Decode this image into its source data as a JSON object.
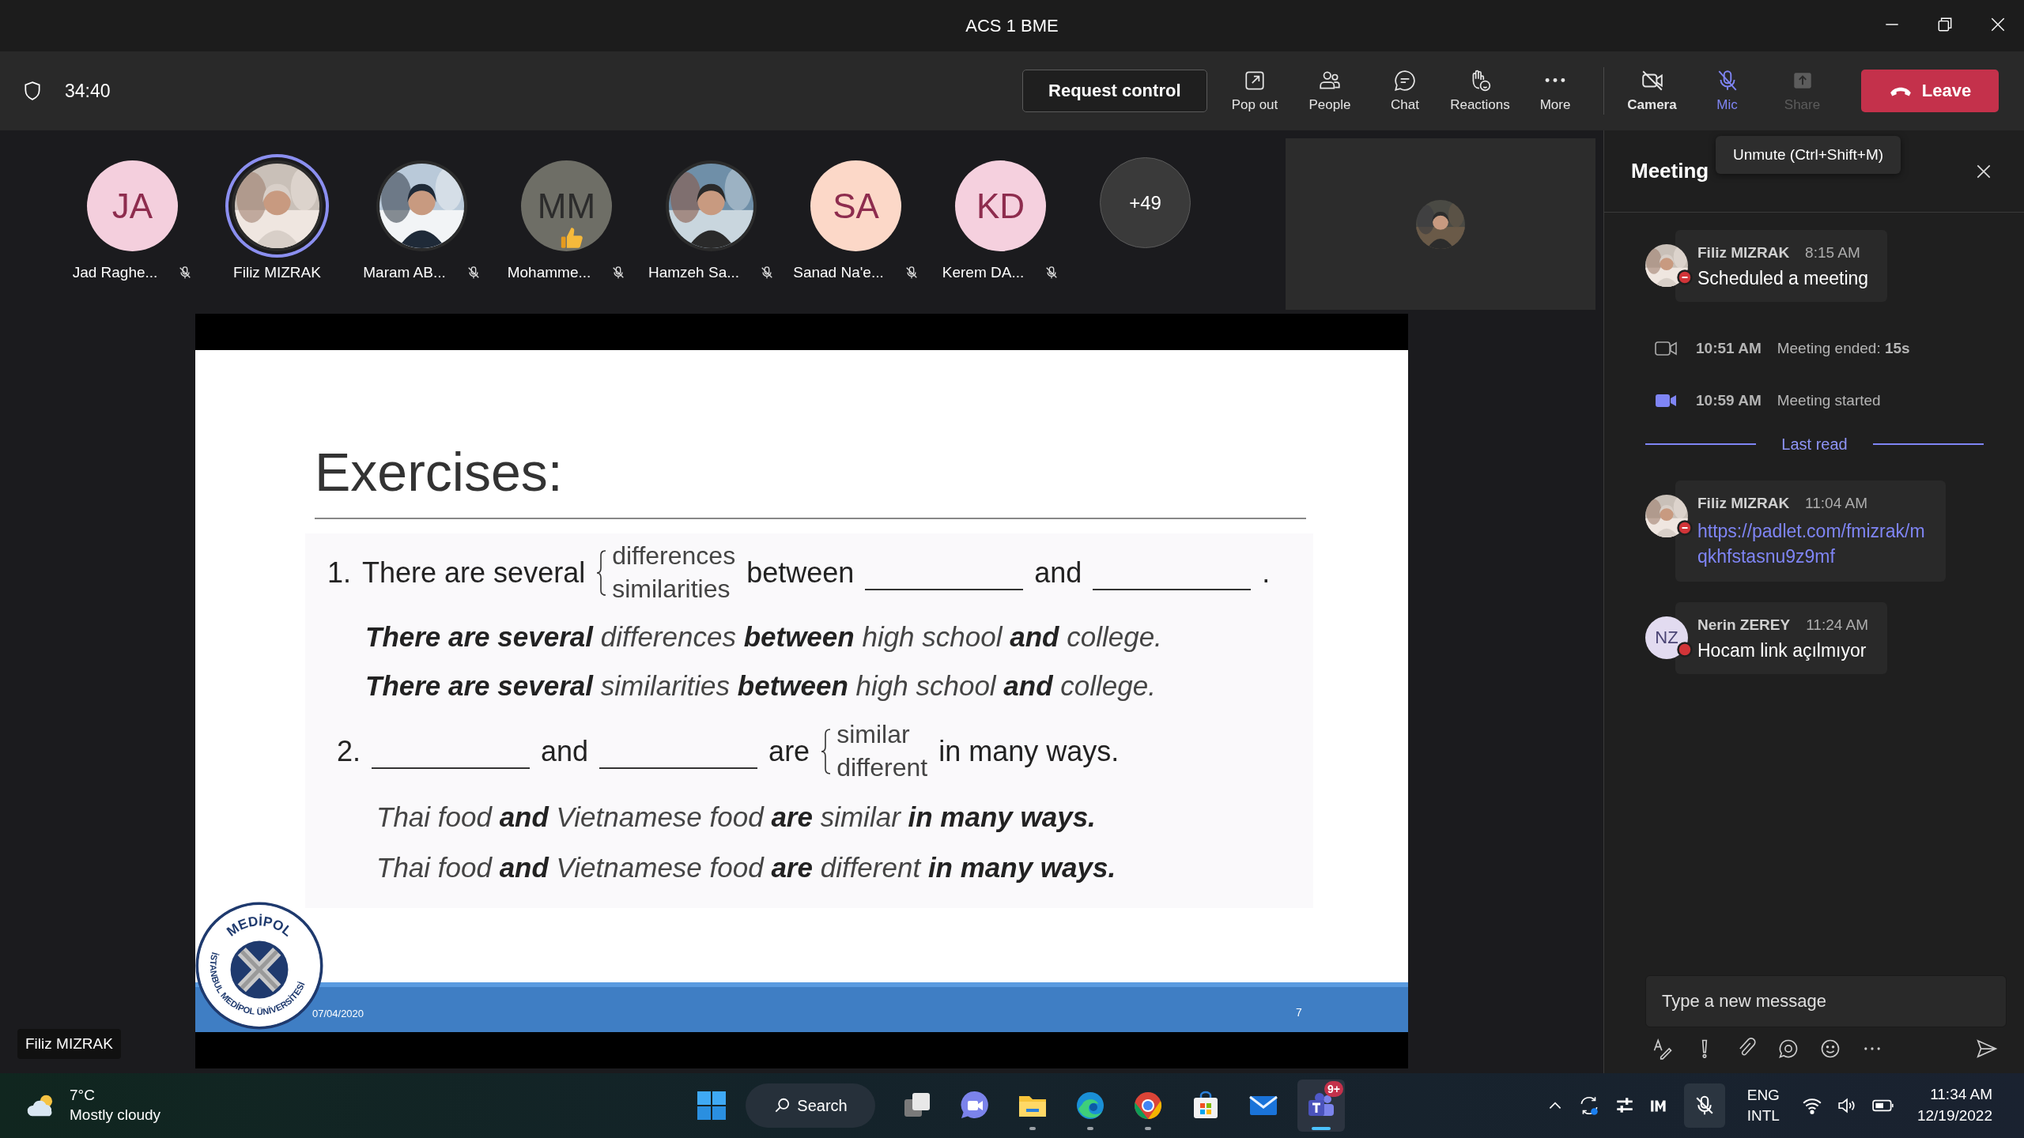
{
  "window": {
    "title": "ACS 1 BME"
  },
  "meeting_bar": {
    "timer": "34:40",
    "request_control": "Request control",
    "actions": [
      {
        "label": "Pop out",
        "kind": "popout"
      },
      {
        "label": "People",
        "kind": "people"
      },
      {
        "label": "Chat",
        "kind": "chat"
      },
      {
        "label": "Reactions",
        "kind": "reactions"
      },
      {
        "label": "More",
        "kind": "more"
      }
    ],
    "devices": [
      {
        "label": "Camera",
        "kind": "camera",
        "on": false,
        "selected": false,
        "disabled": false
      },
      {
        "label": "Mic",
        "kind": "mic",
        "on": false,
        "selected": true,
        "disabled": false
      },
      {
        "label": "Share",
        "kind": "share",
        "on": false,
        "selected": false,
        "disabled": true
      }
    ],
    "leave": "Leave"
  },
  "tooltip": "Unmute (Ctrl+Shift+M)",
  "participants": [
    {
      "kind": "initials",
      "initials": "JA",
      "color": "#f4cfdd",
      "name": "Jad Raghe...",
      "muted": true,
      "speaking": false,
      "reacted": false
    },
    {
      "name": "Filiz MIZRAK",
      "muted": false,
      "speaking": true,
      "reacted": false
    },
    {
      "name": "Maram AB...",
      "muted": true,
      "speaking": false,
      "reacted": false
    },
    {
      "kind": "initials",
      "initials": "MM",
      "color": "#6e6e66",
      "name": "Mohamme...",
      "muted": true,
      "speaking": false,
      "reacted": true
    },
    {
      "name": "Hamzeh Sa...",
      "muted": true,
      "speaking": false,
      "reacted": false
    },
    {
      "kind": "initials",
      "initials": "SA",
      "color": "#fcd8c8",
      "name": "Sanad Na'e...",
      "muted": true,
      "speaking": false,
      "reacted": false
    },
    {
      "kind": "initials",
      "initials": "KD",
      "color": "#f5d0de",
      "name": "Kerem DA...",
      "muted": true,
      "speaking": false,
      "reacted": false
    }
  ],
  "more_participants": "+49",
  "presenter": "Filiz MIZRAK",
  "slide": {
    "title": "Exercises:",
    "exercises": [
      {
        "number": "1.",
        "parts": [
          {
            "kind": "text",
            "text": "There are several"
          },
          {
            "kind": "choice",
            "options": [
              "differences",
              "similarities"
            ]
          },
          {
            "kind": "text",
            "text": "between"
          },
          {
            "kind": "blank"
          },
          {
            "kind": "text",
            "text": "and"
          },
          {
            "kind": "blank"
          },
          {
            "kind": "text",
            "text": "."
          }
        ],
        "examples": [
          "**There are several** differences **between** high school **and** college.",
          "**There are several** similarities **between** high school **and** college."
        ]
      },
      {
        "number": "2.",
        "parts": [
          {
            "kind": "blank"
          },
          {
            "kind": "text",
            "text": "and"
          },
          {
            "kind": "blank"
          },
          {
            "kind": "text",
            "text": "are"
          },
          {
            "kind": "choice",
            "options": [
              "similar",
              "different"
            ]
          },
          {
            "kind": "text",
            "text": "in many ways."
          }
        ],
        "examples": [
          "Thai food **and** Vietnamese food **are** similar **in many ways.**",
          "Thai food **and** Vietnamese food **are** different **in many ways.**"
        ]
      }
    ],
    "logo": {
      "top": "MEDİPOL",
      "ring": "İSTANBUL MEDİPOL ÜNİVERSİTESİ"
    },
    "date": "07/04/2020",
    "page": "7"
  },
  "chat": {
    "title": "Meeting",
    "items": [
      {
        "kind": "message",
        "author": "Filiz MIZRAK",
        "time": "8:15 AM",
        "photo": true,
        "dnd": true,
        "text": "Scheduled a meeting",
        "link": false
      },
      {
        "kind": "event",
        "time": "10:51 AM",
        "text": "Meeting ended: **15s**",
        "live": false
      },
      {
        "kind": "event",
        "time": "10:59 AM",
        "text": "Meeting started",
        "live": true
      },
      {
        "kind": "divider",
        "text": "Last read"
      },
      {
        "kind": "message",
        "author": "Filiz MIZRAK",
        "time": "11:04 AM",
        "photo": true,
        "dnd": true,
        "text": "https://padlet.com/fmizrak/mqkhfstasnu9z9mf",
        "link": true
      },
      {
        "kind": "message",
        "author": "Nerin ZEREY",
        "time": "11:24 AM",
        "photo": false,
        "initials": "NZ",
        "dnd": false,
        "text": "Hocam link açılmıyor",
        "link": false
      }
    ],
    "composer": {
      "placeholder": "Type a new message"
    }
  },
  "taskbar": {
    "weather": {
      "temp": "7°C",
      "condition": "Mostly cloudy"
    },
    "search": "Search",
    "apps": [
      {
        "kind": "taskview",
        "running": false,
        "selected": false
      },
      {
        "kind": "teams-chat",
        "running": false,
        "selected": false
      },
      {
        "kind": "explorer",
        "running": true,
        "selected": false
      },
      {
        "kind": "edge",
        "running": true,
        "selected": false
      },
      {
        "kind": "chrome",
        "running": true,
        "selected": false
      },
      {
        "kind": "store",
        "running": false,
        "selected": false
      },
      {
        "kind": "mail",
        "running": false,
        "selected": false
      },
      {
        "kind": "teams",
        "running": true,
        "selected": true,
        "badge": "9+"
      }
    ],
    "tray": {
      "language": "ENG",
      "layout": "INTL",
      "time": "11:34 AM",
      "date": "12/19/2022"
    }
  }
}
